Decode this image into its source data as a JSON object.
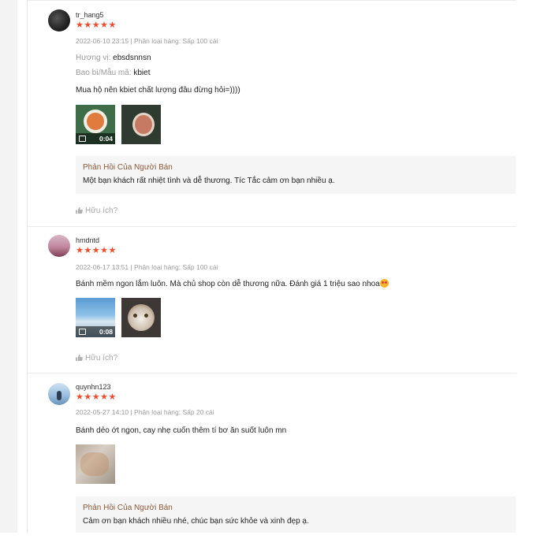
{
  "reviews": [
    {
      "username": "tr_hang5",
      "stars": "★★★★★",
      "meta": "2022-06-10 23:15 | Phân loại hàng: Sấp 100 cái",
      "attrs": [
        {
          "key": "Hương vị:",
          "value": "ebsdsnnsn"
        },
        {
          "key": "Bao bì/Mẫu mã:",
          "value": "kbiet"
        }
      ],
      "comment": "Mua hộ nên kbiet chất lượng đâu đừng hỏi=))))",
      "media": [
        {
          "type": "video",
          "duration": "0:04"
        },
        {
          "type": "image"
        }
      ],
      "reply": {
        "title": "Phản Hồi Của Người Bán",
        "text": "Một bạn khách rất nhiệt tình và dễ thương. Tíc Tắc cảm ơn bạn nhiều ạ."
      },
      "helpful": "Hữu ích?"
    },
    {
      "username": "hmdntd",
      "stars": "★★★★★",
      "meta": "2022-06-17 13:51 | Phân loại hàng: Sấp 100 cái",
      "comment": "Bánh mềm ngon lắm luôn. Mà chủ shop còn dễ thương nữa. Đánh giá 1 triệu sao nhoa",
      "media": [
        {
          "type": "video",
          "duration": "0:08"
        },
        {
          "type": "image"
        }
      ],
      "helpful": "Hữu ích?"
    },
    {
      "username": "quynhn123",
      "stars": "★★★★★",
      "meta": "2022-05-27 14:10 | Phân loại hàng: Sấp 20 cái",
      "comment": "Bánh dẻo ớt ngon, cay nhẹ cuốn thêm tí bơ ăn suốt luôn mn",
      "media": [
        {
          "type": "image"
        }
      ],
      "reply": {
        "title": "Phản Hồi Của Người Bán",
        "text": "Cảm ơn bạn khách nhiều nhé, chúc bạn sức khỏe và xinh đẹp ạ."
      }
    }
  ],
  "colors": {
    "star": "#ee4d2d",
    "reply_title": "#8a5a3a",
    "reply_bg": "#f5f5f5"
  },
  "icons": {
    "helpful": "thumbs-up-icon",
    "video": "video-camera-icon"
  }
}
